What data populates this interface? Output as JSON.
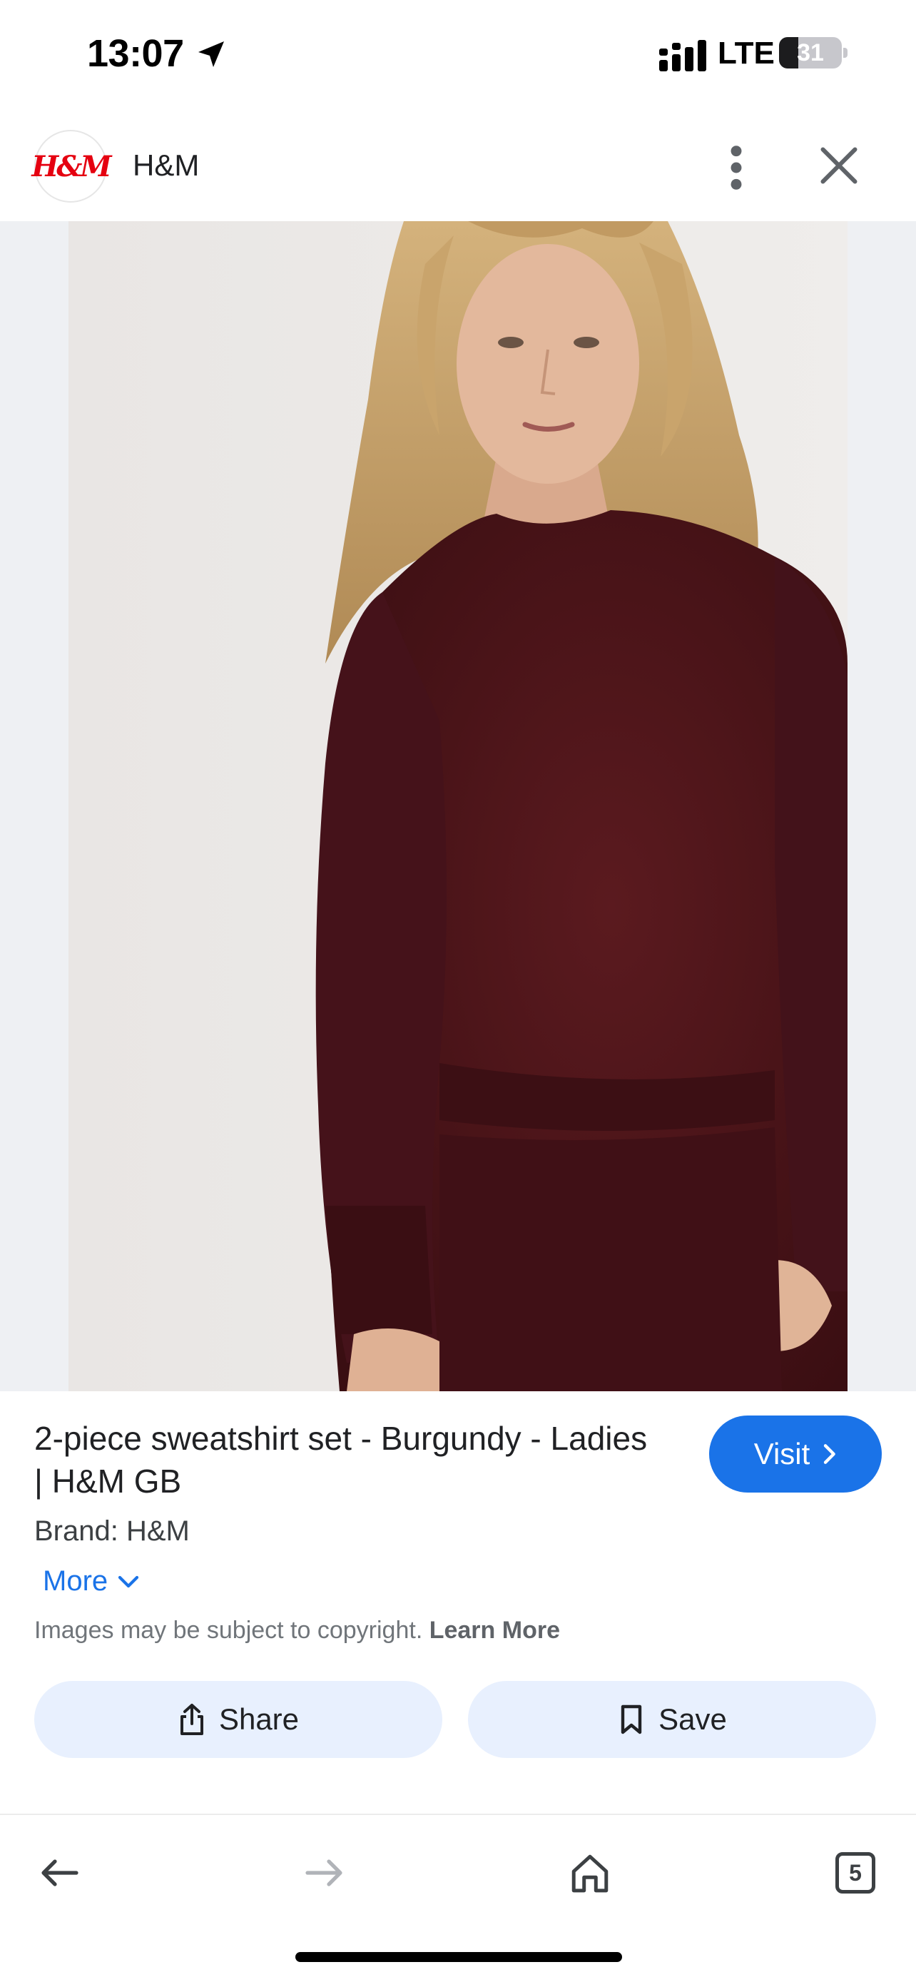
{
  "status_bar": {
    "time": "13:07",
    "network": "LTE",
    "battery_percent": "31",
    "battery_level": 0.31,
    "icons": [
      "location-arrow-icon",
      "signal-icon",
      "battery-icon"
    ]
  },
  "header": {
    "site_name": "H&M",
    "logo_text": "H&M",
    "logo_color": "#e50010",
    "icons": [
      "more-vert-icon",
      "close-icon"
    ]
  },
  "product": {
    "title": "2-piece sweatshirt set - Burgundy - Ladies | H&M GB",
    "brand": "Brand: H&M",
    "more_label": "More",
    "copyright_text": "Images may be subject to copyright.",
    "learn_more_label": "Learn More",
    "visit_label": "Visit",
    "share_label": "Share",
    "save_label": "Save",
    "garment_color": "#4e1419"
  },
  "bottom_nav": {
    "tab_count": "5",
    "icons": [
      "back-arrow-icon",
      "forward-arrow-icon",
      "home-icon",
      "tabs-icon"
    ]
  },
  "colors": {
    "accent": "#1a73e8",
    "button_tint": "#e8f0fe"
  }
}
